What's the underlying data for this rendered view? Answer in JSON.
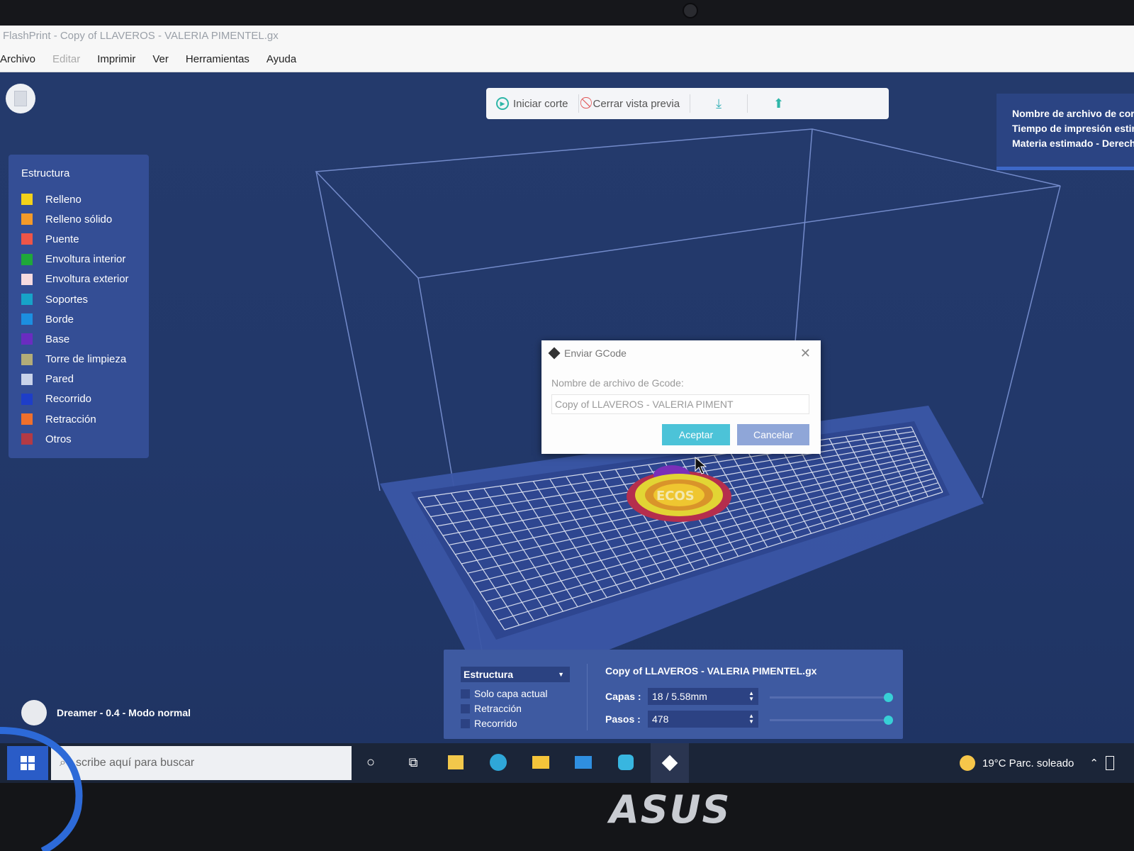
{
  "window": {
    "title": "FlashPrint - Copy of LLAVEROS - VALERIA PIMENTEL.gx"
  },
  "menu": [
    "Archivo",
    "Editar",
    "Imprimir",
    "Ver",
    "Herramientas",
    "Ayuda"
  ],
  "toolbar": {
    "start_slice": "Iniciar corte",
    "close_preview": "Cerrar vista previa"
  },
  "info": {
    "line1": "Nombre de archivo de cor",
    "line2": "Tiempo de impresión estin",
    "line3": "Materia estimado - Derech"
  },
  "legend": {
    "title": "Estructura",
    "items": [
      {
        "label": "Relleno",
        "color": "#f2d21a"
      },
      {
        "label": "Relleno sólido",
        "color": "#f39a2a"
      },
      {
        "label": "Puente",
        "color": "#ee5548"
      },
      {
        "label": "Envoltura interior",
        "color": "#1fa83a"
      },
      {
        "label": "Envoltura exterior",
        "color": "#f7dbe0"
      },
      {
        "label": "Soportes",
        "color": "#17a3c8"
      },
      {
        "label": "Borde",
        "color": "#1c8fe0"
      },
      {
        "label": "Base",
        "color": "#6a2cc0"
      },
      {
        "label": "Torre de limpieza",
        "color": "#b3ac78"
      },
      {
        "label": "Pared",
        "color": "#c9d3ea"
      },
      {
        "label": "Recorrido",
        "color": "#1e3ec8"
      },
      {
        "label": "Retracción",
        "color": "#ef6f2c"
      },
      {
        "label": "Otros",
        "color": "#b33a45"
      }
    ]
  },
  "dialog": {
    "title": "Enviar GCode",
    "label": "Nombre de archivo de Gcode:",
    "filename_value": "Copy of LLAVEROS - VALERIA PIMENT",
    "accept": "Aceptar",
    "cancel": "Cancelar"
  },
  "model_label": "ECOS",
  "bottom": {
    "view_select": "Estructura",
    "checks": [
      "Solo capa actual",
      "Retracción",
      "Recorrido"
    ],
    "filename": "Copy of LLAVEROS - VALERIA PIMENTEL.gx",
    "layers_label": "Capas :",
    "layers_value": "18 / 5.58mm",
    "layers_fraction": 1.0,
    "steps_label": "Pasos :",
    "steps_value": "478",
    "steps_fraction": 1.0
  },
  "printer_status": "Dreamer - 0.4 - Modo normal",
  "taskbar": {
    "search_placeholder": "scribe aquí para buscar",
    "weather": "19°C Parc. soleado"
  },
  "brand": "ASUS",
  "colors": {
    "viewport_bg": "#22386a",
    "accent_cyan": "#4cc3d8",
    "panel_blue": "#344e95"
  }
}
